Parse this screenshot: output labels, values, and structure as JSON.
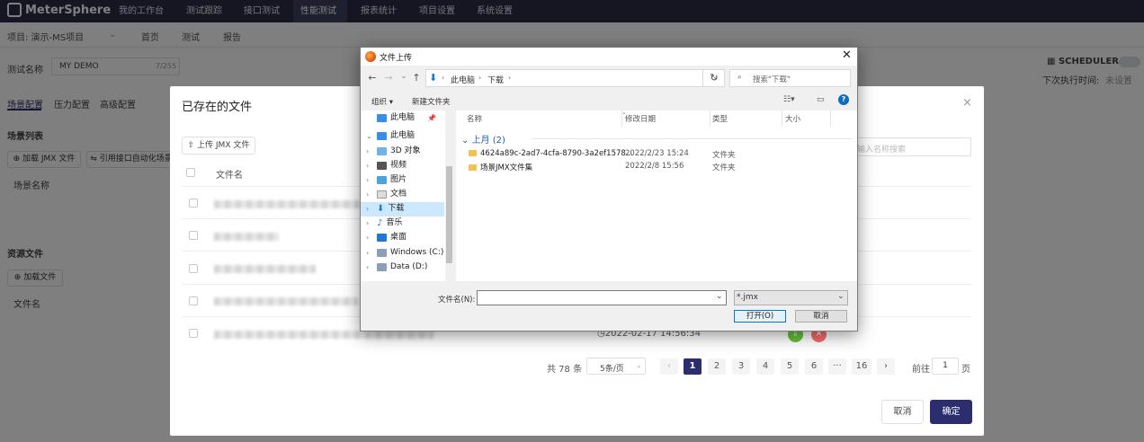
{
  "app": {
    "name": "MeterSphere"
  },
  "nav": {
    "items": [
      "我的工作台",
      "测试跟踪",
      "接口测试",
      "性能测试",
      "报表统计",
      "项目设置",
      "系统设置"
    ]
  },
  "subheader": {
    "project": "项目: 演示-MS项目",
    "home": "首页",
    "test": "测试",
    "report": "报告"
  },
  "page": {
    "test_name_label": "测试名称",
    "test_name_value": "MY DEMO",
    "test_name_count": "7/255",
    "scheduler": "SCHEDULER",
    "next_run_label": "下次执行时间:",
    "next_run_value": "未设置",
    "tabs": [
      "场景配置",
      "压力配置",
      "高级配置"
    ],
    "scene_list": "场景列表",
    "load_jmx": "加载 JMX 文件",
    "ref_scene": "引用接口自动化场景",
    "scene_name": "场景名称",
    "resource_files": "资源文件",
    "load_file": "加载文件",
    "file_name": "文件名"
  },
  "existing_dialog": {
    "title": "已存在的文件",
    "upload_btn": "上传 JMX 文件",
    "search_placeholder": "请输入名称搜索",
    "col_filename": "文件名",
    "timestamp": "2022-02-17 14:56:34",
    "pagination": {
      "total": "共 78 条",
      "page_size": "5条/页",
      "pages": [
        "1",
        "2",
        "3",
        "4",
        "5",
        "6",
        "···",
        "16"
      ],
      "current": "1",
      "goto_label": "前往",
      "goto_value": "1",
      "page_suffix": "页"
    },
    "cancel": "取消",
    "confirm": "确定"
  },
  "file_dialog": {
    "title": "文件上传",
    "path": [
      "此电脑",
      "下载"
    ],
    "search_placeholder": "搜索\"下载\"",
    "organize": "组织 ▾",
    "new_folder": "新建文件夹",
    "tree": [
      "此电脑",
      "此电脑",
      "3D 对象",
      "视频",
      "图片",
      "文档",
      "下载",
      "音乐",
      "桌面",
      "Windows (C:)",
      "Data (D:)"
    ],
    "columns": [
      "名称",
      "修改日期",
      "类型",
      "大小"
    ],
    "group": "上月 (2)",
    "files": [
      {
        "name": "4624a89c-2ad7-4cfa-8790-3a2ef1578...",
        "date": "2022/2/23 15:24",
        "type": "文件夹"
      },
      {
        "name": "场景JMX文件集",
        "date": "2022/2/8 15:56",
        "type": "文件夹"
      }
    ],
    "filename_label": "文件名(N):",
    "filename_value": "",
    "filter": "*.jmx",
    "open": "打开(O)",
    "cancel": "取消"
  },
  "colors": {
    "nav_bg": "#2b2d42",
    "primary": "#2b2d6e",
    "accent_blue": "#0078d7"
  }
}
